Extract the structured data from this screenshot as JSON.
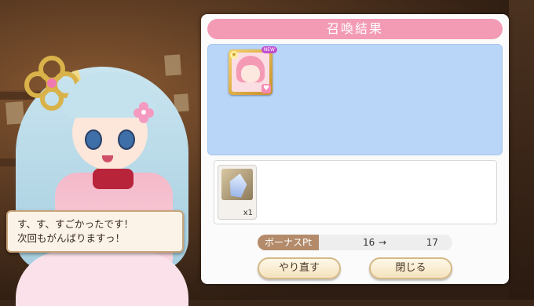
{
  "dialogue": {
    "line1": "す、す、すごかったです！",
    "line2": "次回もがんばりますっ！"
  },
  "panel": {
    "title": "召喚結果",
    "result_card": {
      "badge": "NEW",
      "rarity_icon": "star-icon",
      "affinity_icon": "heart-icon"
    },
    "item": {
      "quantity": "x1"
    },
    "bonus": {
      "label": "ボーナスPt",
      "from": "16",
      "arrow": "→",
      "to": "17"
    },
    "buttons": {
      "redo": "やり直す",
      "close": "閉じる"
    }
  },
  "colors": {
    "title_bar": "#f39bb5",
    "result_area": "#b9d5f8",
    "bonus_label": "#b38b6a",
    "button_border": "#d5b988"
  }
}
